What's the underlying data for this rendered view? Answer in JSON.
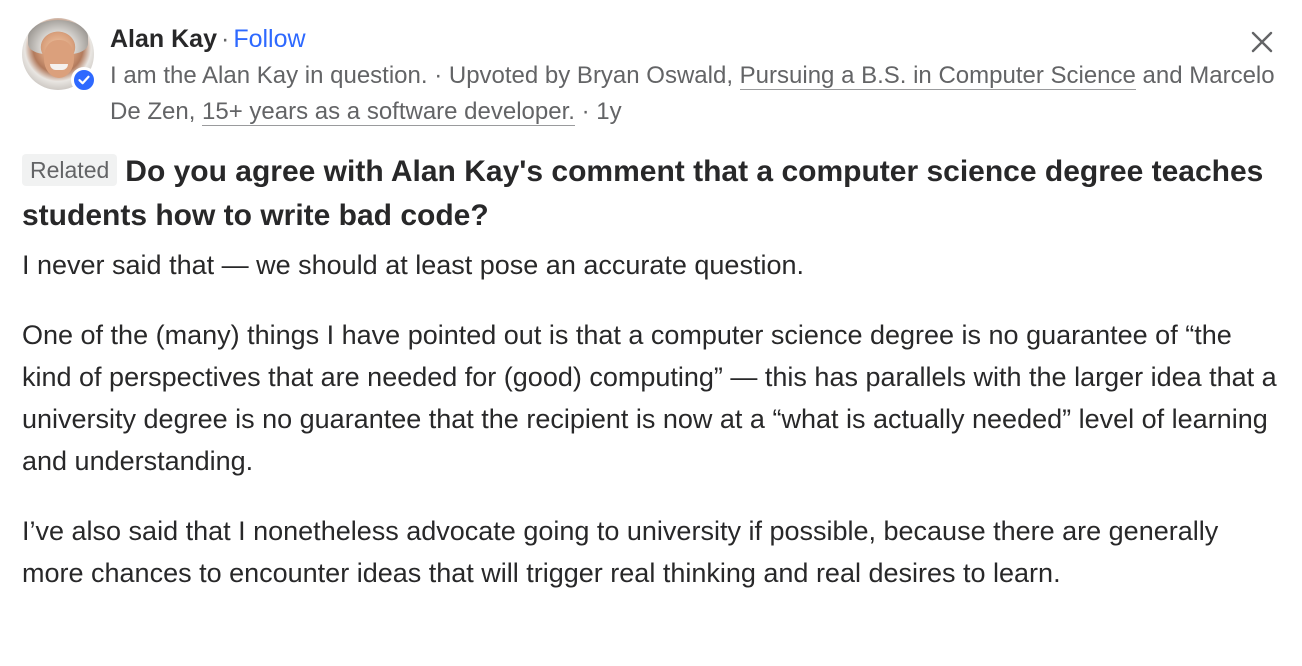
{
  "author": {
    "name": "Alan Kay",
    "separator": "·",
    "follow_label": "Follow",
    "credential_prefix": "I am the Alan Kay in question. · Upvoted by Bryan Oswald, ",
    "upvoter1_cred": "Pursuing a B.S. in Computer Science",
    "credential_middle": " and Marcelo De Zen, ",
    "upvoter2_cred": "15+ years as a software developer.",
    "credential_suffix": " · 1y",
    "avatar_icon": "avatar-photo",
    "verified_icon": "verified-check-icon",
    "accent_color": "#2e69ff"
  },
  "close_icon": "close-icon",
  "question": {
    "tag": "Related",
    "title": "Do you agree with Alan Kay's comment that a computer science degree teaches students how to write bad code?"
  },
  "answer": {
    "paragraphs": [
      "I never said that — we should at least pose an accurate question.",
      "One of the (many) things I have pointed out is that a computer science degree is no guarantee of “the kind of perspectives that are needed for (good) computing” — this has parallels with the larger idea that a university degree is no guarantee that the recipient is now at a “what is actually needed” level of learning and understanding.",
      "I’ve also said that I nonetheless advocate going to university if possible, because there are generally more chances to encounter ideas that will trigger real thinking and real desires to learn."
    ]
  }
}
